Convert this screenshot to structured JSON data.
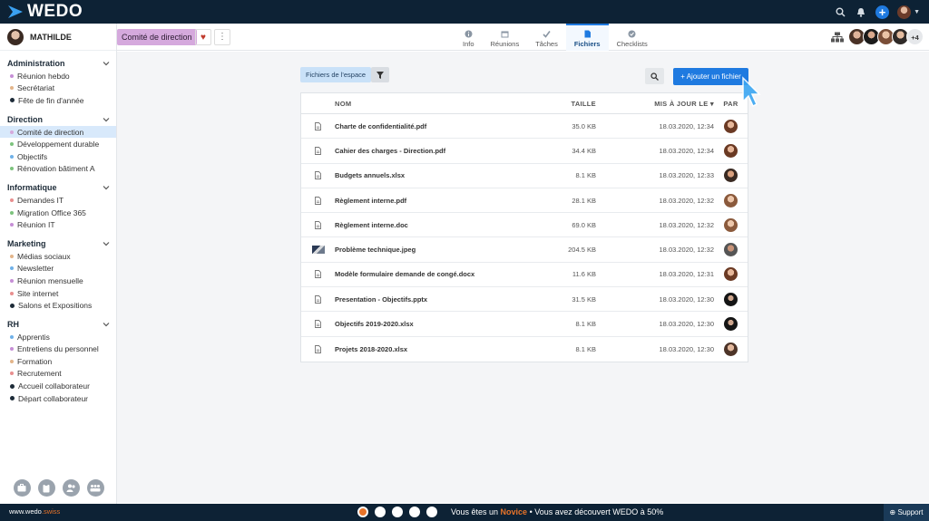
{
  "brand": {
    "name": "WEDO",
    "footer_url_main": "www.wedo",
    "footer_url_suffix": ".swiss"
  },
  "user": {
    "name": "MATHILDE"
  },
  "sidebar": {
    "sections": [
      {
        "title": "Administration",
        "items": [
          {
            "label": "Réunion hebdo",
            "color": "#c68fd6"
          },
          {
            "label": "Secrétariat",
            "color": "#e3b58a"
          },
          {
            "label": "Fête de fin d'année",
            "color": "check"
          }
        ]
      },
      {
        "title": "Direction",
        "items": [
          {
            "label": "Comité de direction",
            "color": "#d5a9dd",
            "active": true
          },
          {
            "label": "Développement durable",
            "color": "#7cc37d"
          },
          {
            "label": "Objectifs",
            "color": "#6fb1e8"
          },
          {
            "label": "Rénovation bâtiment A",
            "color": "#7cc37d"
          }
        ]
      },
      {
        "title": "Informatique",
        "items": [
          {
            "label": "Demandes IT",
            "color": "#e88f8f"
          },
          {
            "label": "Migration Office 365",
            "color": "#7cc37d"
          },
          {
            "label": "Réunion IT",
            "color": "#c68fd6"
          }
        ]
      },
      {
        "title": "Marketing",
        "items": [
          {
            "label": "Médias sociaux",
            "color": "#e3b58a"
          },
          {
            "label": "Newsletter",
            "color": "#6fb1e8"
          },
          {
            "label": "Réunion mensuelle",
            "color": "#c68fd6"
          },
          {
            "label": "Site internet",
            "color": "#e88f8f"
          },
          {
            "label": "Salons et Expositions",
            "color": "check"
          }
        ]
      },
      {
        "title": "RH",
        "items": [
          {
            "label": "Apprentis",
            "color": "#6fb1e8"
          },
          {
            "label": "Entretiens du personnel",
            "color": "#c68fd6"
          },
          {
            "label": "Formation",
            "color": "#e3b58a"
          },
          {
            "label": "Recrutement",
            "color": "#e88f8f"
          },
          {
            "label": "Accueil collaborateur",
            "color": "check"
          },
          {
            "label": "Départ collaborateur",
            "color": "check"
          }
        ]
      }
    ]
  },
  "header": {
    "space": "Comité de direction",
    "tabs": [
      {
        "label": "Info",
        "icon": "info-icon"
      },
      {
        "label": "Réunions",
        "icon": "calendar-icon"
      },
      {
        "label": "Tâches",
        "icon": "check-icon"
      },
      {
        "label": "Fichiers",
        "icon": "file-icon",
        "active": true
      },
      {
        "label": "Checklists",
        "icon": "checklist-icon"
      }
    ],
    "members_more": "+4"
  },
  "files": {
    "filter_label": "Fichiers de l'espace",
    "add_label": "+ Ajouter un fichier",
    "columns": {
      "name": "NOM",
      "size": "TAILLE",
      "updated": "MIS À JOUR LE ▾",
      "by": "PAR"
    },
    "rows": [
      {
        "name": "Charte de confidentialité.pdf",
        "size": "35.0 KB",
        "date": "18.03.2020, 12:34",
        "type": "doc",
        "avatar": "a"
      },
      {
        "name": "Cahier des charges - Direction.pdf",
        "size": "34.4 KB",
        "date": "18.03.2020, 12:34",
        "type": "doc",
        "avatar": "a"
      },
      {
        "name": "Budgets annuels.xlsx",
        "size": "8.1 KB",
        "date": "18.03.2020, 12:33",
        "type": "doc",
        "avatar": "b"
      },
      {
        "name": "Règlement interne.pdf",
        "size": "28.1 KB",
        "date": "18.03.2020, 12:32",
        "type": "doc",
        "avatar": "c"
      },
      {
        "name": "Règlement interne.doc",
        "size": "69.0 KB",
        "date": "18.03.2020, 12:32",
        "type": "doc",
        "avatar": "c"
      },
      {
        "name": "Problème technique.jpeg",
        "size": "204.5 KB",
        "date": "18.03.2020, 12:32",
        "type": "image",
        "avatar": "d"
      },
      {
        "name": "Modèle formulaire demande de congé.docx",
        "size": "11.6 KB",
        "date": "18.03.2020, 12:31",
        "type": "doc",
        "avatar": "a"
      },
      {
        "name": "Presentation - Objectifs.pptx",
        "size": "31.5 KB",
        "date": "18.03.2020, 12:30",
        "type": "doc",
        "avatar": "e"
      },
      {
        "name": "Objectifs 2019-2020.xlsx",
        "size": "8.1 KB",
        "date": "18.03.2020, 12:30",
        "type": "doc",
        "avatar": "e"
      },
      {
        "name": "Projets 2018-2020.xlsx",
        "size": "8.1 KB",
        "date": "18.03.2020, 12:30",
        "type": "doc",
        "avatar": "f"
      }
    ]
  },
  "footer": {
    "msg_prefix": "Vous êtes un ",
    "level": "Novice",
    "msg_suffix": " • Vous avez découvert WEDO à 50%",
    "support": "Support"
  }
}
